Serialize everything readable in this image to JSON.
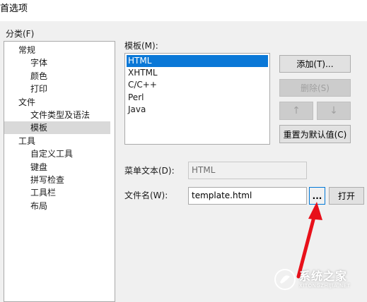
{
  "window": {
    "title": "首选项"
  },
  "category": {
    "label": "分类(F)",
    "items": [
      {
        "label": "常规",
        "level": 0,
        "selected": false
      },
      {
        "label": "字体",
        "level": 1,
        "selected": false
      },
      {
        "label": "颜色",
        "level": 1,
        "selected": false
      },
      {
        "label": "打印",
        "level": 1,
        "selected": false
      },
      {
        "label": "文件",
        "level": 0,
        "selected": false
      },
      {
        "label": "文件类型及语法",
        "level": 1,
        "selected": false
      },
      {
        "label": "模板",
        "level": 1,
        "selected": true
      },
      {
        "label": "工具",
        "level": 0,
        "selected": false
      },
      {
        "label": "自定义工具",
        "level": 1,
        "selected": false
      },
      {
        "label": "键盘",
        "level": 1,
        "selected": false
      },
      {
        "label": "拼写检查",
        "level": 1,
        "selected": false
      },
      {
        "label": "工具栏",
        "level": 1,
        "selected": false
      },
      {
        "label": "布局",
        "level": 1,
        "selected": false
      }
    ]
  },
  "templates": {
    "label": "模板(M):",
    "items": [
      {
        "label": "HTML",
        "selected": true
      },
      {
        "label": "XHTML",
        "selected": false
      },
      {
        "label": "C/C++",
        "selected": false
      },
      {
        "label": "Perl",
        "selected": false
      },
      {
        "label": "Java",
        "selected": false
      }
    ]
  },
  "buttons": {
    "add": "添加(T)...",
    "delete": "删除(S)",
    "up": "↑",
    "down": "↓",
    "reset": "重置为默认值(C)",
    "browse": "...",
    "open": "打开"
  },
  "fields": {
    "menu_text_label": "菜单文本(D):",
    "menu_text_value": "HTML",
    "filename_label": "文件名(W):",
    "filename_value": "template.html"
  },
  "watermark": {
    "main": "系统之家",
    "sub": "XITONGZHIJIA.NET"
  },
  "colors": {
    "selection": "#0a78d7",
    "annotation_arrow": "#e8101a"
  }
}
